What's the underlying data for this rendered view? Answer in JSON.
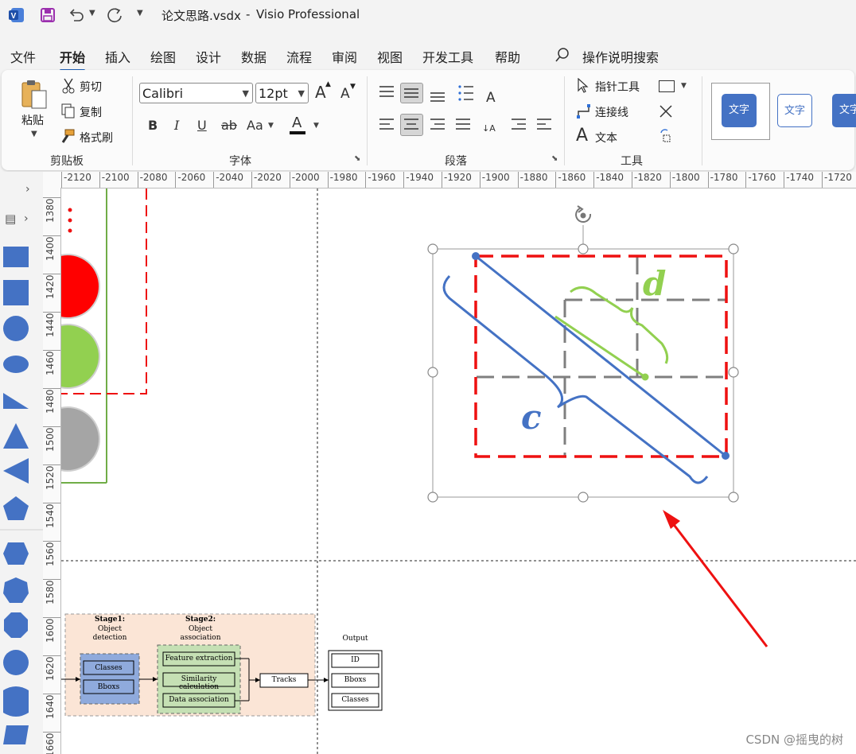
{
  "window": {
    "file_name": "论文思路.vsdx",
    "separator": "-",
    "app_name": "Visio Professional"
  },
  "menu": [
    "文件",
    "开始",
    "插入",
    "绘图",
    "设计",
    "数据",
    "流程",
    "审阅",
    "视图",
    "开发工具",
    "帮助"
  ],
  "search_label": "操作说明搜索",
  "ribbon": {
    "clipboard": {
      "paste": "粘贴",
      "cut": "剪切",
      "copy": "复制",
      "format_painter": "格式刷",
      "label": "剪贴板"
    },
    "font": {
      "name": "Calibri",
      "size": "12pt",
      "bold": "B",
      "italic": "I",
      "underline": "U",
      "strike": "ab",
      "case": "Aa",
      "color_letter": "A",
      "label": "字体",
      "grow": "A",
      "shrink": "A"
    },
    "paragraph": {
      "label": "段落"
    },
    "tools": {
      "pointer": "指针工具",
      "connector": "连接线",
      "text": "文本",
      "text_glyph": "A",
      "label": "工具"
    },
    "styles": [
      "文字",
      "文字",
      "文字"
    ]
  },
  "ruler": {
    "h_ticks": [
      "-2120",
      "-2100",
      "-2080",
      "-2060",
      "-2040",
      "-2020",
      "-2000",
      "-1980",
      "-1960",
      "-1940",
      "-1920",
      "-1900",
      "-1880",
      "-1860",
      "-1840",
      "-1820",
      "-1800",
      "-1780",
      "-1760",
      "-1740",
      "-1720"
    ],
    "v_ticks": [
      "1380",
      "1400",
      "1420",
      "1440",
      "1460",
      "1480",
      "1500",
      "1520",
      "1540",
      "1560",
      "1580",
      "1600",
      "1620",
      "1640",
      "1660"
    ]
  },
  "diagram": {
    "label_d": "d",
    "label_c": "c",
    "colors": {
      "red": "#ee1111",
      "blue": "#4472c4",
      "green": "#92d050",
      "gray": "#7f7f7f"
    }
  },
  "flow": {
    "stage1_title": "Stage1:",
    "stage1_sub1": "Object",
    "stage1_sub2": "detection",
    "stage2_title": "Stage2:",
    "stage2_sub1": "Object",
    "stage2_sub2": "association",
    "output_title": "Output",
    "classes": "Classes",
    "bboxs": "Bboxs",
    "feature": "Feature extraction",
    "similarity": "Similarity calculation",
    "data_assoc": "Data association",
    "tracks": "Tracks",
    "out_id": "ID",
    "out_bboxs": "Bboxs",
    "out_classes": "Classes"
  },
  "watermark": "CSDN @摇曳的树"
}
